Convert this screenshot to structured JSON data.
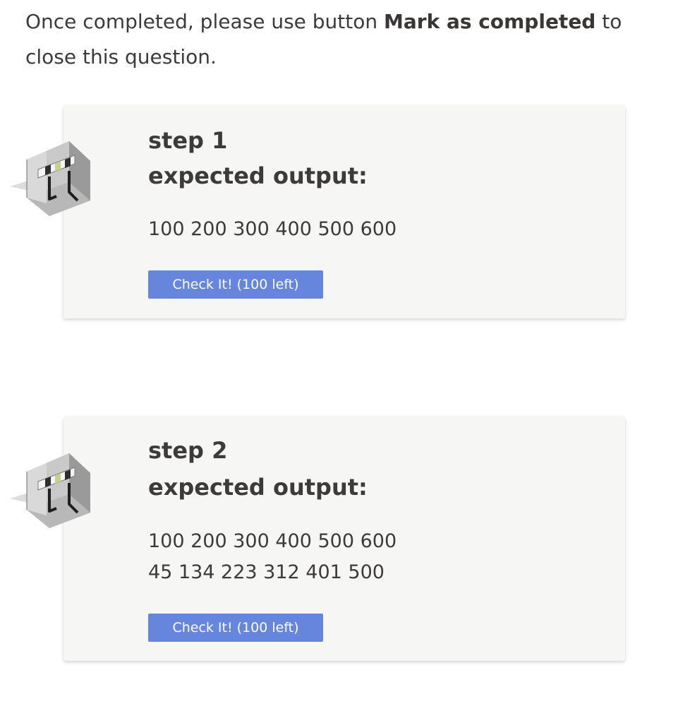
{
  "intro": {
    "prefix": "Once completed, please use button ",
    "bold": "Mark as completed",
    "suffix": " to close this question."
  },
  "steps": [
    {
      "title": "step 1",
      "label": "expected output:",
      "output_lines": [
        "100 200 300 400 500 600"
      ],
      "button_label": "Check It! (100 left)",
      "icon": "workbench-cube-icon"
    },
    {
      "title": "step 2",
      "label": "expected output:",
      "output_lines": [
        "100 200 300 400 500 600",
        "45 134 223 312 401 500"
      ],
      "button_label": "Check It! (100 left)",
      "icon": "workbench-cube-icon"
    }
  ],
  "colors": {
    "button": "#6686dd",
    "card_background": "#f6f7f5",
    "text": "#3d3a3a"
  }
}
